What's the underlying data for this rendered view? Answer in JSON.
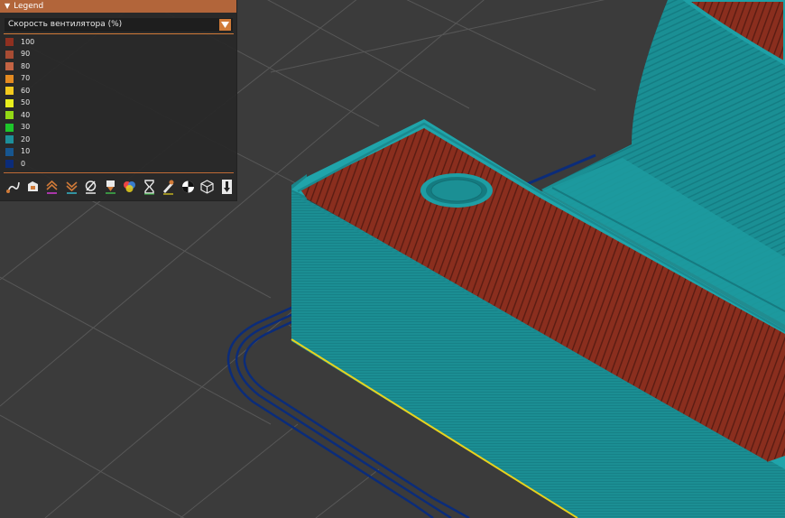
{
  "legend": {
    "title": "Legend",
    "dropdown_value": "Скорость вентилятора (%)",
    "items": [
      {
        "label": "100",
        "color": "#8f3020"
      },
      {
        "label": "90",
        "color": "#a84c33"
      },
      {
        "label": "80",
        "color": "#c36343"
      },
      {
        "label": "70",
        "color": "#e38a21"
      },
      {
        "label": "60",
        "color": "#f2c91e"
      },
      {
        "label": "50",
        "color": "#e8ee1d"
      },
      {
        "label": "40",
        "color": "#93d915"
      },
      {
        "label": "30",
        "color": "#1ec52b"
      },
      {
        "label": "20",
        "color": "#1d8f9a"
      },
      {
        "label": "10",
        "color": "#17568f"
      },
      {
        "label": "0",
        "color": "#0b2c7a"
      }
    ],
    "toolbar_icons": [
      "travel-icon",
      "wipe-icon",
      "retractions-icon",
      "deretractions-icon",
      "seams-icon",
      "tool-changes-icon",
      "color-changes-icon",
      "pause-icon",
      "custom-gcode-icon",
      "center-of-gravity-icon",
      "shells-icon",
      "tool-marker-icon"
    ]
  },
  "colors": {
    "background": "#3b3b3b",
    "grid": "#595959",
    "body_teal": "#1a8e92",
    "infill_red": "#8f3020",
    "travel_blue": "#0b2c7a",
    "first_layer_yellow": "#e8d21d",
    "accent_orange": "#d07a38"
  }
}
